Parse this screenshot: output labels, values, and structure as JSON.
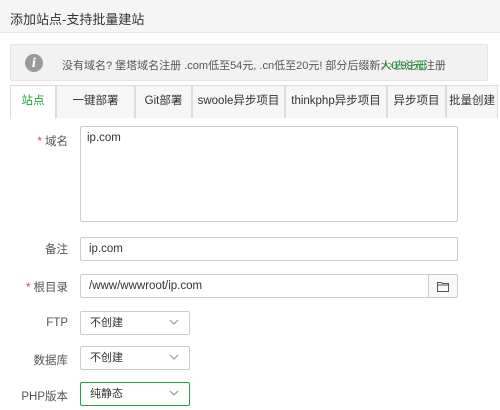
{
  "window": {
    "title": "添加站点-支持批量建站"
  },
  "notice": {
    "icon": "info-icon",
    "message": "没有域名? 堡塔域名注册 .com低至54元,  .cn低至20元! 部分后缀新人0.99元注册",
    "link_label": ">>去注册"
  },
  "tabs": [
    {
      "label": "站点",
      "active": true
    },
    {
      "label": "一键部署",
      "active": false
    },
    {
      "label": "Git部署",
      "active": false
    },
    {
      "label": "swoole异步项目",
      "active": false
    },
    {
      "label": "thinkphp异步项目",
      "active": false
    },
    {
      "label": "异步项目",
      "active": false
    },
    {
      "label": "批量创建",
      "active": false
    }
  ],
  "form": {
    "domain": {
      "label": "域名",
      "required": "*",
      "value": "ip.com"
    },
    "remark": {
      "label": "备注",
      "value": "ip.com"
    },
    "root": {
      "label": "根目录",
      "required": "*",
      "value": "/www/wwwroot/ip.com",
      "button_icon": "folder-icon"
    },
    "ftp": {
      "label": "FTP",
      "value": "不创建"
    },
    "database": {
      "label": "数据库",
      "value": "不创建"
    },
    "php": {
      "label": "PHP版本",
      "value": "纯静态"
    }
  },
  "colors": {
    "accent": "#20a53a",
    "required": "#e4393c"
  }
}
